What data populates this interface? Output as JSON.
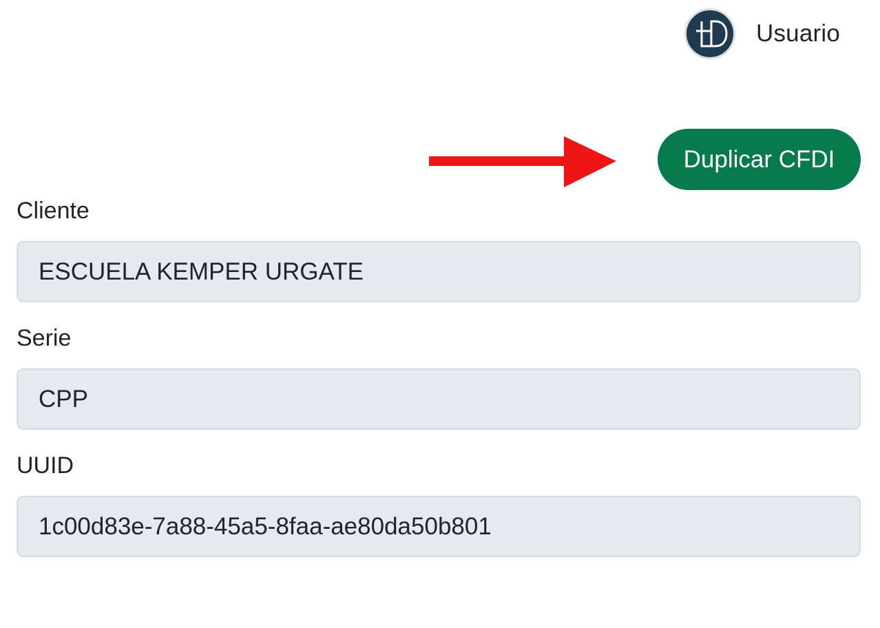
{
  "header": {
    "user_name": "Usuario",
    "avatar_icon": "logo-avatar-icon"
  },
  "actions": {
    "duplicate_label": "Duplicar CFDI",
    "duplicate_color": "#067a4a",
    "annotation_arrow_color": "#f01515"
  },
  "form": {
    "cliente": {
      "label": "Cliente",
      "value": "ESCUELA KEMPER URGATE"
    },
    "serie": {
      "label": "Serie",
      "value": "CPP"
    },
    "uuid": {
      "label": "UUID",
      "value": "1c00d83e-7a88-45a5-8faa-ae80da50b801"
    }
  }
}
